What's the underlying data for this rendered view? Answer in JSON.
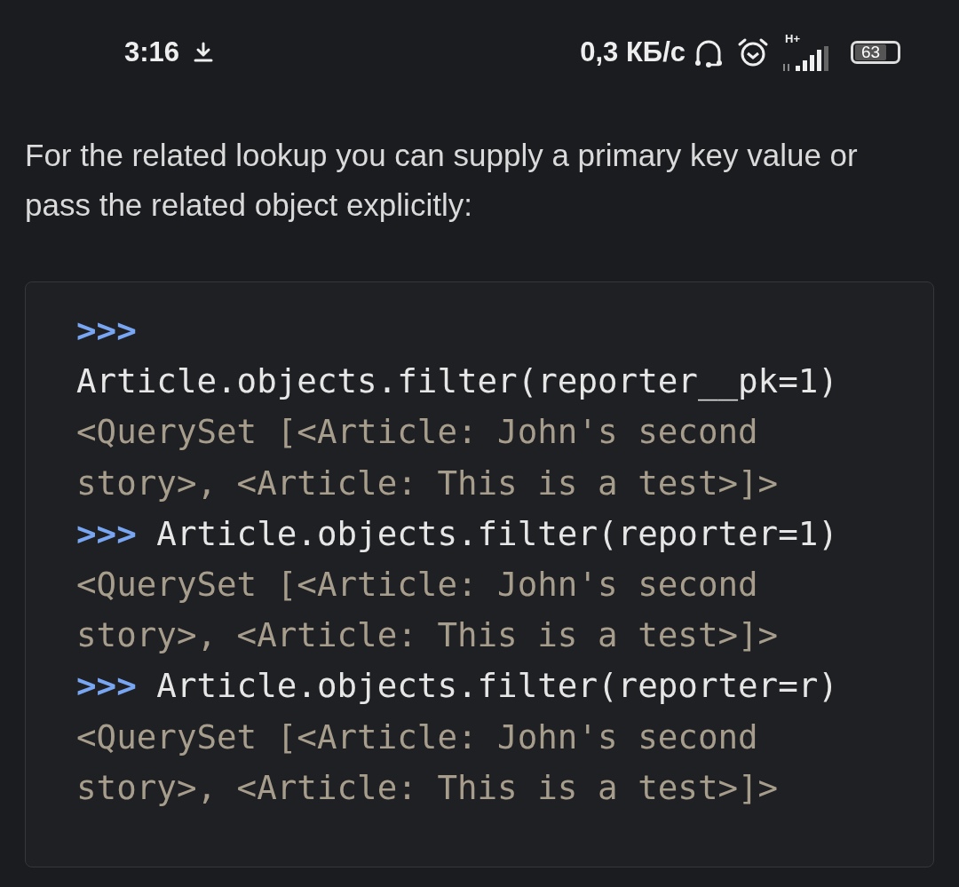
{
  "status_bar": {
    "time": "3:16",
    "speed": "0,3 КБ/с",
    "network": "H+",
    "battery": "63"
  },
  "paragraph": "For the related lookup you can supply a primary key value or pass the related object explicitly:",
  "code_block": [
    {
      "prompt": ">>>",
      "input": "Article.objects.filter(reporter__pk=1)",
      "output": "<QuerySet [<Article: John's second story>, <Article: This is a test>]>"
    },
    {
      "prompt": ">>>",
      "input": "Article.objects.filter(reporter=1)",
      "output": "<QuerySet [<Article: John's second story>, <Article: This is a test>]>"
    },
    {
      "prompt": ">>>",
      "input": "Article.objects.filter(reporter=r)",
      "output": "<QuerySet [<Article: John's second story>, <Article: This is a test>]>"
    }
  ]
}
